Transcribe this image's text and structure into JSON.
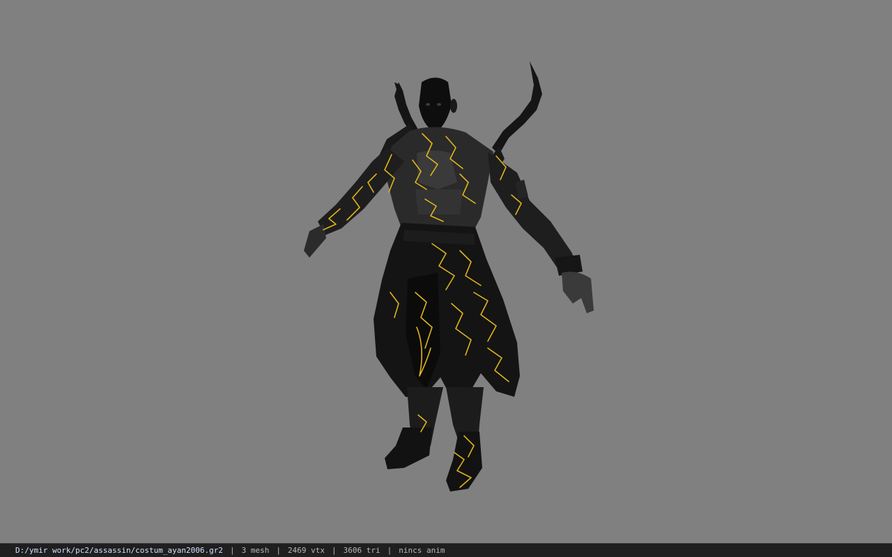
{
  "viewer": {
    "background_color": "#808080",
    "model": {
      "name": "character-model",
      "palette": {
        "body": "#141414",
        "shadow": "#0a0a0a",
        "cloth": "#1b1b1b",
        "skin_highlight": "#4c4c4c",
        "pattern": "#e2b51a"
      }
    }
  },
  "statusbar": {
    "file_path": "D:/ymir work/pc2/assassin/costum_ayan2006.gr2",
    "separator": "|",
    "mesh_count": "3 mesh",
    "vertex_count": "2469 vtx",
    "triangle_count": "3606 tri",
    "animation": "nincs anim"
  }
}
